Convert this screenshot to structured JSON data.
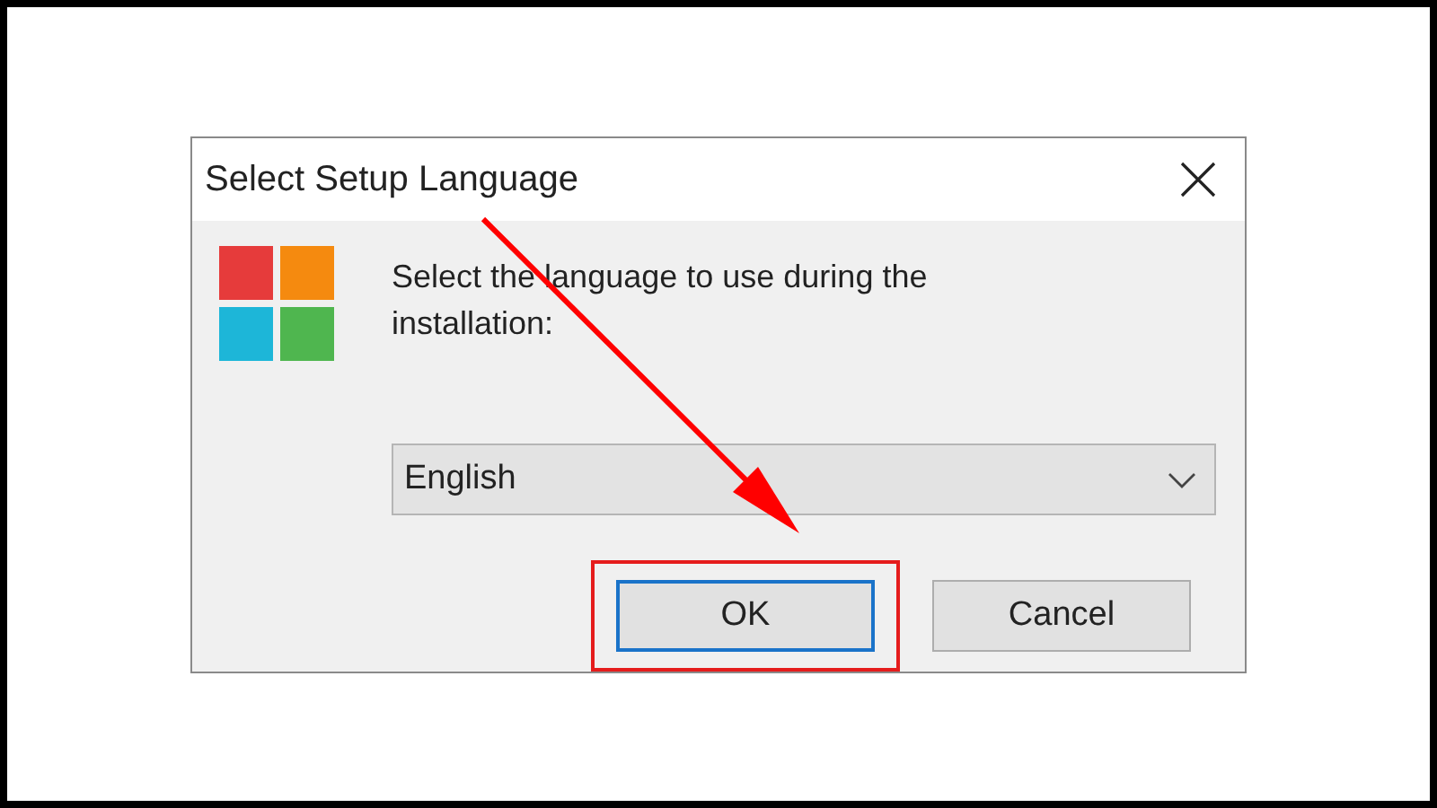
{
  "window": {
    "title": "Select Setup Language"
  },
  "message": "Select the language to use during the installation:",
  "language_dropdown": {
    "value": "English"
  },
  "buttons": [
    {
      "label": "OK",
      "default": true,
      "highlighted": true
    },
    {
      "label": "Cancel",
      "default": false,
      "highlighted": false
    }
  ]
}
